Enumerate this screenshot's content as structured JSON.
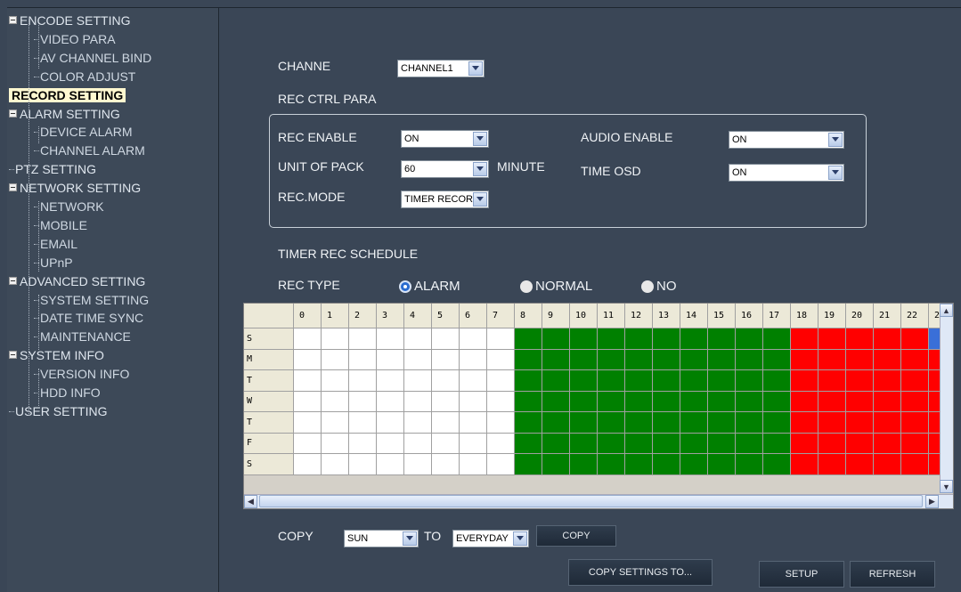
{
  "sidebar": {
    "items": [
      {
        "label": "ENCODE SETTING",
        "level": 0,
        "expander": true
      },
      {
        "label": "VIDEO PARA",
        "level": 1
      },
      {
        "label": "AV CHANNEL BIND",
        "level": 1
      },
      {
        "label": "COLOR ADJUST",
        "level": 1
      },
      {
        "label": "RECORD SETTING",
        "level": 0,
        "active": true
      },
      {
        "label": "ALARM SETTING",
        "level": 0,
        "expander": true
      },
      {
        "label": "DEVICE ALARM",
        "level": 1
      },
      {
        "label": "CHANNEL ALARM",
        "level": 1
      },
      {
        "label": "PTZ SETTING",
        "level": 0
      },
      {
        "label": "NETWORK SETTING",
        "level": 0,
        "expander": true
      },
      {
        "label": "NETWORK",
        "level": 1
      },
      {
        "label": "MOBILE",
        "level": 1
      },
      {
        "label": "EMAIL",
        "level": 1
      },
      {
        "label": "UPnP",
        "level": 1
      },
      {
        "label": "ADVANCED SETTING",
        "level": 0,
        "expander": true
      },
      {
        "label": "SYSTEM SETTING",
        "level": 1
      },
      {
        "label": "DATE TIME SYNC",
        "level": 1
      },
      {
        "label": "MAINTENANCE",
        "level": 1
      },
      {
        "label": "SYSTEM INFO",
        "level": 0,
        "expander": true
      },
      {
        "label": "VERSION INFO",
        "level": 1
      },
      {
        "label": "HDD INFO",
        "level": 1
      },
      {
        "label": "USER SETTING",
        "level": 0
      }
    ]
  },
  "main": {
    "channel_label": "CHANNE",
    "channel_value": "CHANNEL1",
    "rec_ctrl_title": "REC CTRL PARA",
    "rec_enable_label": "REC ENABLE",
    "rec_enable_value": "ON",
    "unit_of_pack_label": "UNIT OF PACK",
    "unit_of_pack_value": "60",
    "minute_label": "MINUTE",
    "rec_mode_label": "REC.MODE",
    "rec_mode_value": "TIMER RECOR",
    "audio_enable_label": "AUDIO ENABLE",
    "audio_enable_value": "ON",
    "time_osd_label": "TIME OSD",
    "time_osd_value": "ON",
    "timer_schedule_title": "TIMER REC SCHEDULE",
    "rec_type_label": "REC TYPE",
    "rec_type_options": [
      {
        "label": "ALARM",
        "selected": true
      },
      {
        "label": "NORMAL",
        "selected": false
      },
      {
        "label": "NO",
        "selected": false
      }
    ],
    "copy_label": "COPY",
    "copy_from_value": "SUN",
    "to_label": "TO",
    "copy_to_value": "EVERYDAY",
    "copy_button": "COPY",
    "copy_settings_button": "COPY SETTINGS TO...",
    "setup_button": "SETUP",
    "refresh_button": "REFRESH"
  },
  "schedule": {
    "hours": [
      "0",
      "1",
      "2",
      "3",
      "4",
      "5",
      "6",
      "7",
      "8",
      "9",
      "10",
      "11",
      "12",
      "13",
      "14",
      "15",
      "16",
      "17",
      "18",
      "19",
      "20",
      "21",
      "22",
      "2"
    ],
    "days": [
      "S",
      "M",
      "T",
      "W",
      "T",
      "F",
      "S"
    ],
    "colors": {
      "none": "#ffffff",
      "normal": "#008000",
      "alarm": "#ff0000",
      "selected": "#3a6fd8"
    },
    "row_pattern": [
      "none",
      "none",
      "none",
      "none",
      "none",
      "none",
      "none",
      "none",
      "normal",
      "normal",
      "normal",
      "normal",
      "normal",
      "normal",
      "normal",
      "normal",
      "normal",
      "normal",
      "alarm",
      "alarm",
      "alarm",
      "alarm",
      "alarm",
      "alarm"
    ]
  },
  "icons": {
    "expander": "minus-box-icon",
    "dropdown": "chevron-down-icon",
    "scroll_up": "arrow-up-icon",
    "scroll_down": "arrow-down-icon",
    "scroll_left": "arrow-left-icon",
    "scroll_right": "arrow-right-icon"
  }
}
